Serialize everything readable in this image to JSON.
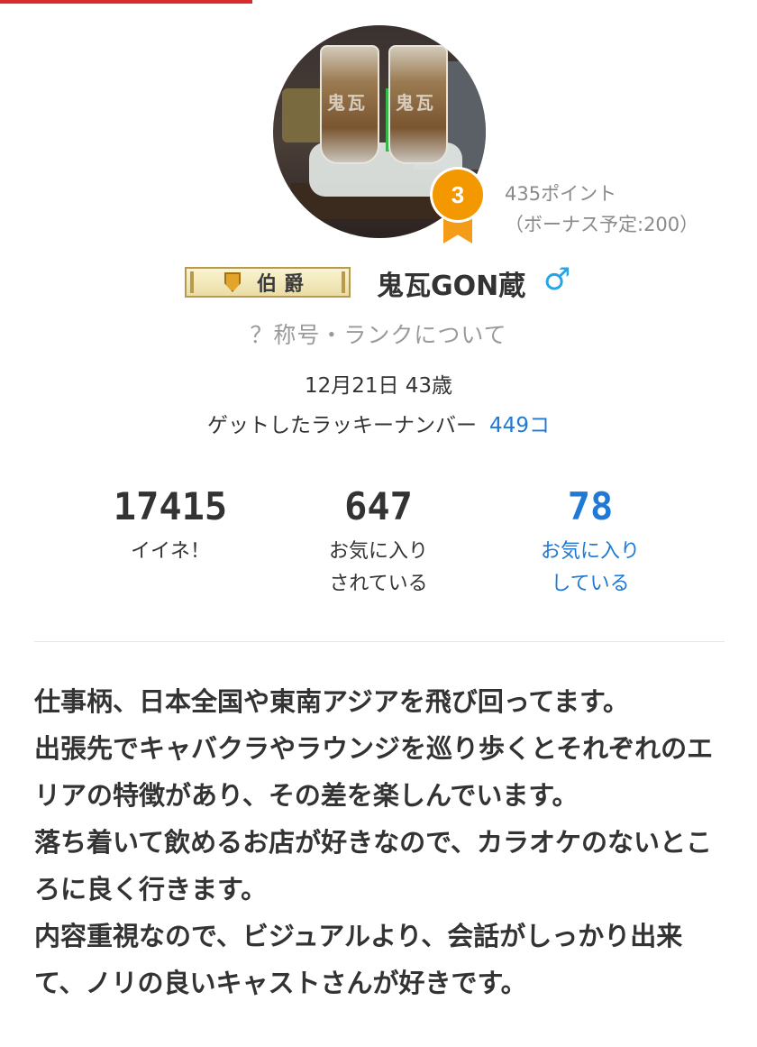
{
  "profile": {
    "title_badge": "伯爵",
    "username": "鬼瓦GON蔵",
    "gender_symbol": "♂",
    "rank_number": "3",
    "points": "435ポイント",
    "bonus": "（ボーナス予定:200）",
    "rank_link": "？称号・ランクについて",
    "birthday_age": "12月21日 43歳",
    "lucky_label": "ゲットしたラッキーナンバー",
    "lucky_count": "449コ"
  },
  "stats": [
    {
      "value": "17415",
      "label_line1": "イイネ！",
      "label_line2": ""
    },
    {
      "value": "647",
      "label_line1": "お気に入り",
      "label_line2": "されている"
    },
    {
      "value": "78",
      "label_line1": "お気に入り",
      "label_line2": "している"
    }
  ],
  "bio": [
    "仕事柄、日本全国や東南アジアを飛び回ってます。",
    "出張先でキャバクラやラウンジを巡り歩くとそれぞれのエリアの特徴があり、その差を楽しんでいます。",
    "落ち着いて飲めるお店が好きなので、カラオケのないところに良く行きます。",
    "内容重視なので、ビジュアルより、会話がしっかり出来て、ノリの良いキャストさんが好きです。"
  ],
  "colors": {
    "accent_blue": "#1e7ad6",
    "rank_orange": "#f39800",
    "gender_blue": "#29a3e8",
    "muted_gray": "#9a9a9a"
  }
}
